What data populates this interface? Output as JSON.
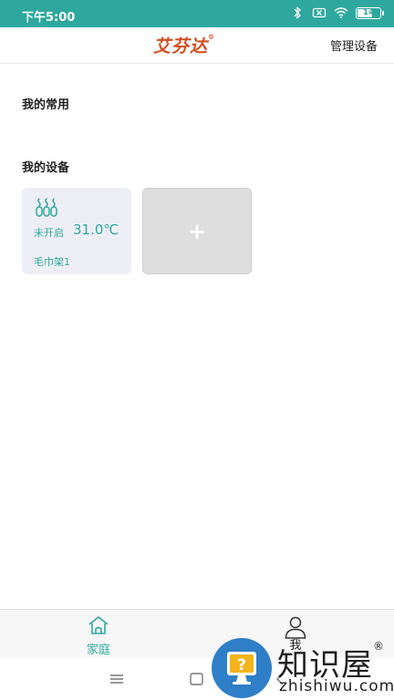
{
  "status_bar": {
    "time": "下午5:00",
    "battery": "14",
    "background_color": "#2ea89e"
  },
  "header": {
    "brand": "艾芬达",
    "brand_mark": "®",
    "manage_label": "管理设备"
  },
  "sections": {
    "common_title": "我的常用",
    "devices_title": "我的设备"
  },
  "devices": [
    {
      "icon": "towel-rack-icon",
      "state": "未开启",
      "temperature": "31.0℃",
      "name": "毛巾架1"
    }
  ],
  "add_device": {
    "icon": "plus-icon",
    "label": "+"
  },
  "tabs": [
    {
      "label": "家庭",
      "icon": "home-icon",
      "active": true
    },
    {
      "label": "我",
      "icon": "user-icon",
      "active": false
    }
  ],
  "nav_bar": {
    "buttons": [
      "menu-icon",
      "home-square-icon",
      "back-icon"
    ]
  },
  "watermark": {
    "text": "知识屋",
    "mark": "®",
    "url": "zhishiwu.com"
  },
  "colors": {
    "accent": "#2ea89e",
    "brand": "#d24e20",
    "card_bg": "#eeeff6",
    "add_card_bg": "#dedede"
  }
}
